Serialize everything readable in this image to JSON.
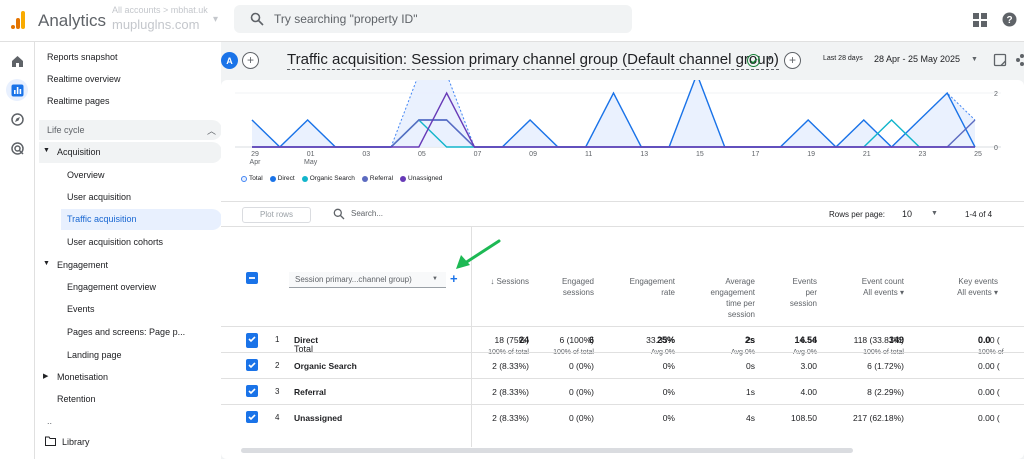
{
  "topbar": {
    "app_title": "Analytics",
    "account_line1": "All accounts > mbhat.uk",
    "account_line2": "mupluglns.com",
    "search_placeholder": "Try searching \"property ID\""
  },
  "rail": {
    "items": [
      "home-icon",
      "reports-icon",
      "explore-icon",
      "advertising-icon"
    ],
    "active": "reports-icon"
  },
  "nav": {
    "reports_snapshot": "Reports snapshot",
    "realtime_overview": "Realtime overview",
    "realtime_pages": "Realtime pages",
    "section": "Life cycle",
    "acquisition": {
      "label": "Acquisition",
      "items": [
        "Overview",
        "User acquisition",
        "Traffic acquisition",
        "User acquisition cohorts"
      ],
      "active_index": 2
    },
    "engagement": {
      "label": "Engagement",
      "items": [
        "Engagement overview",
        "Events",
        "Pages and screens: Page p...",
        "Landing page"
      ]
    },
    "monetisation": "Monetisation",
    "retention": "Retention",
    "ellipsis": "..",
    "library": "Library"
  },
  "header": {
    "avatar_letter": "A",
    "title": "Traffic acquisition: Session primary channel group (Default channel group)",
    "date_pill": "Last 28 days",
    "date_range": "28 Apr - 25 May 2025"
  },
  "chart_data": {
    "type": "line",
    "x": [
      "29 Apr",
      "30",
      "01 May",
      "02",
      "03",
      "04",
      "05",
      "06",
      "07",
      "08",
      "09",
      "10",
      "11",
      "12",
      "13",
      "14",
      "15",
      "16",
      "17",
      "18",
      "19",
      "20",
      "21",
      "22",
      "23",
      "24",
      "25"
    ],
    "x_tick_labels": [
      "29\nApr",
      "01\nMay",
      "03",
      "05",
      "07",
      "09",
      "11",
      "13",
      "15",
      "17",
      "19",
      "21",
      "23",
      "25"
    ],
    "y_right_ticks": [
      "2",
      "0"
    ],
    "ylim": [
      0,
      2
    ],
    "series": [
      {
        "name": "Total",
        "color": "#4285f4",
        "values": [
          1,
          0,
          1,
          0,
          0,
          0,
          3,
          3,
          0,
          0,
          1,
          0,
          0,
          2,
          0,
          0,
          4,
          0,
          0,
          0,
          1,
          0,
          1,
          0,
          1,
          2,
          1
        ]
      },
      {
        "name": "Direct",
        "color": "#1a73e8",
        "values": [
          1,
          0,
          1,
          0,
          0,
          0,
          1,
          1,
          0,
          0,
          1,
          0,
          0,
          2,
          0,
          0,
          4,
          0,
          0,
          0,
          1,
          0,
          1,
          0,
          1,
          2,
          0
        ]
      },
      {
        "name": "Organic Search",
        "color": "#12b5cb",
        "values": [
          0,
          0,
          0,
          0,
          0,
          0,
          1,
          0,
          0,
          0,
          0,
          0,
          0,
          0,
          0,
          0,
          0,
          0,
          0,
          0,
          0,
          0,
          0,
          1,
          0,
          0,
          0
        ]
      },
      {
        "name": "Referral",
        "color": "#5c6bc0",
        "values": [
          0,
          0,
          0,
          0,
          0,
          0,
          1,
          1,
          0,
          0,
          0,
          0,
          0,
          0,
          0,
          0,
          0,
          0,
          0,
          0,
          0,
          0,
          0,
          0,
          0,
          0,
          1
        ]
      },
      {
        "name": "Unassigned",
        "color": "#673ab7",
        "values": [
          0,
          0,
          0,
          0,
          0,
          0,
          0,
          2,
          0,
          0,
          0,
          0,
          0,
          0,
          0,
          0,
          0,
          0,
          0,
          0,
          0,
          0,
          0,
          0,
          0,
          0,
          0
        ]
      }
    ]
  },
  "legend": [
    "Total",
    "Direct",
    "Organic Search",
    "Referral",
    "Unassigned"
  ],
  "controls": {
    "plot_rows": "Plot rows",
    "search_placeholder": "Search...",
    "rows_per_page_label": "Rows per page:",
    "rows_per_page": "10",
    "range": "1-4 of 4"
  },
  "table": {
    "dimension_label": "Session primary...channel group)",
    "columns": [
      {
        "label1": "↓ Sessions",
        "label2": "",
        "label3": "",
        "label4": "",
        "sub": ""
      },
      {
        "label1": "Engaged",
        "label2": "sessions",
        "label3": "",
        "label4": "",
        "sub": ""
      },
      {
        "label1": "Engagement",
        "label2": "rate",
        "label3": "",
        "label4": "",
        "sub": ""
      },
      {
        "label1": "Average",
        "label2": "engagement",
        "label3": "time per",
        "label4": "session",
        "sub": ""
      },
      {
        "label1": "Events",
        "label2": "per",
        "label3": "session",
        "label4": "",
        "sub": ""
      },
      {
        "label1": "Event count",
        "label2": "",
        "label3": "",
        "label4": "",
        "sub": "All events ▾"
      },
      {
        "label1": "Key events",
        "label2": "",
        "label3": "",
        "label4": "",
        "sub": "All events ▾"
      }
    ],
    "total_label": "Total",
    "totals": [
      {
        "value": "24",
        "sub": "100% of total"
      },
      {
        "value": "6",
        "sub": "100% of total"
      },
      {
        "value": "25%",
        "sub": "Avg 0%"
      },
      {
        "value": "2s",
        "sub": "Avg 0%"
      },
      {
        "value": "14.54",
        "sub": "Avg 0%"
      },
      {
        "value": "349",
        "sub": "100% of total"
      },
      {
        "value": "0.0",
        "sub": "100% of"
      }
    ],
    "rows": [
      {
        "index": "1",
        "name": "Direct",
        "cells": [
          "18 (75%)",
          "6 (100%)",
          "33.33%",
          "2s",
          "6.56",
          "118 (33.81%)",
          "0.00 ("
        ]
      },
      {
        "index": "2",
        "name": "Organic Search",
        "cells": [
          "2 (8.33%)",
          "0 (0%)",
          "0%",
          "0s",
          "3.00",
          "6 (1.72%)",
          "0.00 ("
        ]
      },
      {
        "index": "3",
        "name": "Referral",
        "cells": [
          "2 (8.33%)",
          "0 (0%)",
          "0%",
          "1s",
          "4.00",
          "8 (2.29%)",
          "0.00 ("
        ]
      },
      {
        "index": "4",
        "name": "Unassigned",
        "cells": [
          "2 (8.33%)",
          "0 (0%)",
          "0%",
          "4s",
          "108.50",
          "217 (62.18%)",
          "0.00 ("
        ]
      }
    ]
  },
  "colors": {
    "accent": "#1a73e8",
    "annotation_arrow": "#1db954"
  }
}
